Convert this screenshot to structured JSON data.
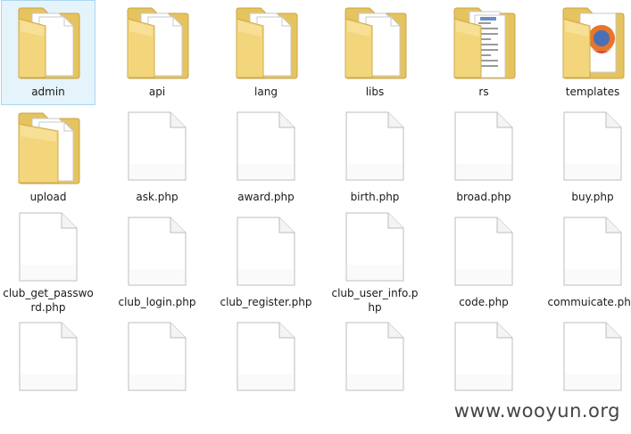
{
  "explorer": {
    "items": [
      {
        "label": "admin",
        "kind": "folder",
        "icon": "folder-icon",
        "selected": true
      },
      {
        "label": "api",
        "kind": "folder",
        "icon": "folder-icon",
        "selected": false
      },
      {
        "label": "lang",
        "kind": "folder",
        "icon": "folder-icon",
        "selected": false
      },
      {
        "label": "libs",
        "kind": "folder",
        "icon": "folder-icon",
        "selected": false
      },
      {
        "label": "rs",
        "kind": "folder-docs",
        "icon": "folder-documents-icon",
        "selected": false
      },
      {
        "label": "templates",
        "kind": "folder-images",
        "icon": "folder-images-icon",
        "selected": false
      },
      {
        "label": "upload",
        "kind": "folder-narrow",
        "icon": "folder-icon",
        "selected": false
      },
      {
        "label": "ask.php",
        "kind": "file",
        "icon": "file-icon",
        "selected": false
      },
      {
        "label": "award.php",
        "kind": "file",
        "icon": "file-icon",
        "selected": false
      },
      {
        "label": "birth.php",
        "kind": "file",
        "icon": "file-icon",
        "selected": false
      },
      {
        "label": "broad.php",
        "kind": "file",
        "icon": "file-icon",
        "selected": false
      },
      {
        "label": "buy.php",
        "kind": "file",
        "icon": "file-icon",
        "selected": false
      },
      {
        "label": "club_get_password.php",
        "kind": "file",
        "icon": "file-icon",
        "selected": false
      },
      {
        "label": "club_login.php",
        "kind": "file",
        "icon": "file-icon",
        "selected": false
      },
      {
        "label": "club_register.php",
        "kind": "file",
        "icon": "file-icon",
        "selected": false
      },
      {
        "label": "club_user_info.php",
        "kind": "file",
        "icon": "file-icon",
        "selected": false
      },
      {
        "label": "code.php",
        "kind": "file",
        "icon": "file-icon",
        "selected": false
      },
      {
        "label": "commuicate.php",
        "kind": "file",
        "icon": "file-icon",
        "selected": false
      },
      {
        "label": "",
        "kind": "file",
        "icon": "file-icon",
        "selected": false
      },
      {
        "label": "",
        "kind": "file",
        "icon": "file-icon",
        "selected": false
      },
      {
        "label": "",
        "kind": "file",
        "icon": "file-icon",
        "selected": false
      },
      {
        "label": "",
        "kind": "file",
        "icon": "file-icon",
        "selected": false
      },
      {
        "label": "",
        "kind": "file",
        "icon": "file-icon",
        "selected": false
      },
      {
        "label": "",
        "kind": "file",
        "icon": "file-icon",
        "selected": false
      }
    ]
  },
  "watermark": {
    "text": "www.wooyun.org"
  },
  "colors": {
    "folder_back": "#e8c766",
    "folder_front": "#f6dc8a",
    "selection_bg": "#e5f3fb",
    "selection_border": "#a8d8f0"
  }
}
